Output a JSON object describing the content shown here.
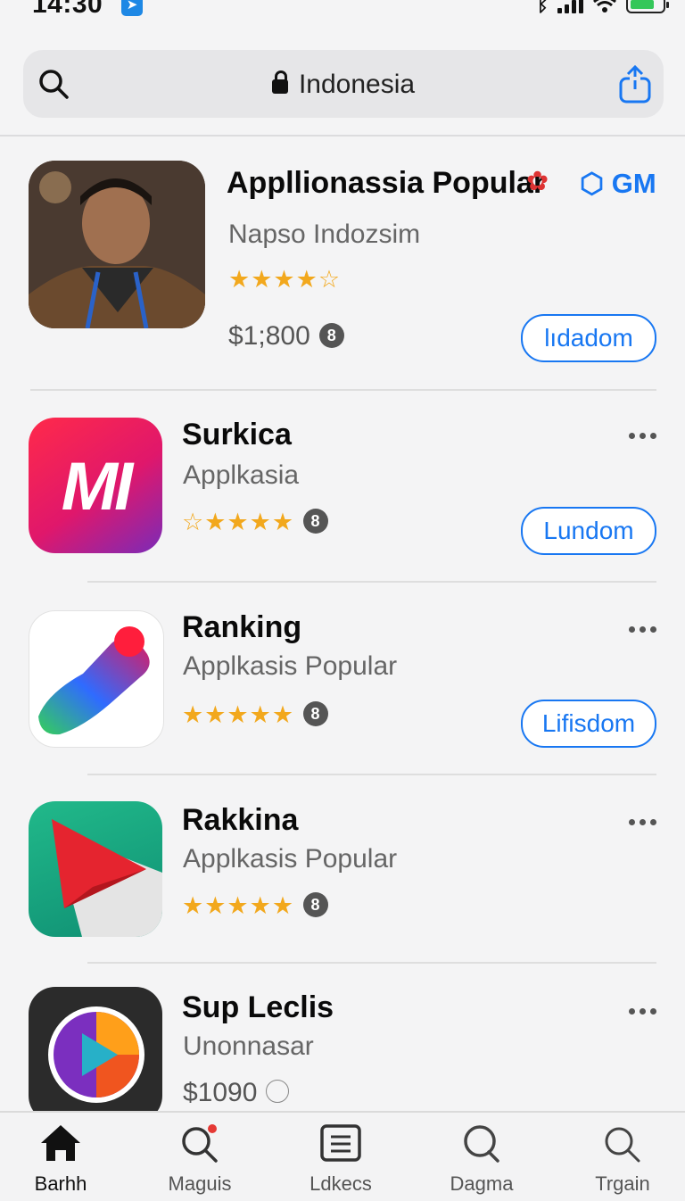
{
  "status": {
    "time": "14:30"
  },
  "address": {
    "text": "Indonesia"
  },
  "featured": {
    "title": "Appllionassia Popular",
    "badge": "GM",
    "subtitle": "Napso Indozsim",
    "rating_stars": 4,
    "price": "$1;800",
    "age": "8",
    "button": "lıdadom"
  },
  "apps": [
    {
      "title": "Surkica",
      "subtitle": "Applkasia",
      "rating_stars": 4,
      "age": "8",
      "button": "Lundom",
      "icon_text": "MI"
    },
    {
      "title": "Ranking",
      "subtitle": "Applkasis Popular",
      "rating_stars": 5,
      "age": "8",
      "button": "Lifisdom"
    },
    {
      "title": "Rakkina",
      "subtitle": "Applkasis Popular",
      "rating_stars": 5,
      "age": "8"
    },
    {
      "title": "Sup Leclis",
      "subtitle": "Unonnasar",
      "price": "$1090"
    }
  ],
  "tabs": [
    {
      "label": "Barhh",
      "icon": "home-icon"
    },
    {
      "label": "Maguis",
      "icon": "search-icon"
    },
    {
      "label": "Ldkecs",
      "icon": "list-icon"
    },
    {
      "label": "Dagma",
      "icon": "search-icon"
    },
    {
      "label": "Trgain",
      "icon": "search-icon"
    }
  ],
  "colors": {
    "accent": "#1877f2",
    "star": "#f2a81d"
  }
}
